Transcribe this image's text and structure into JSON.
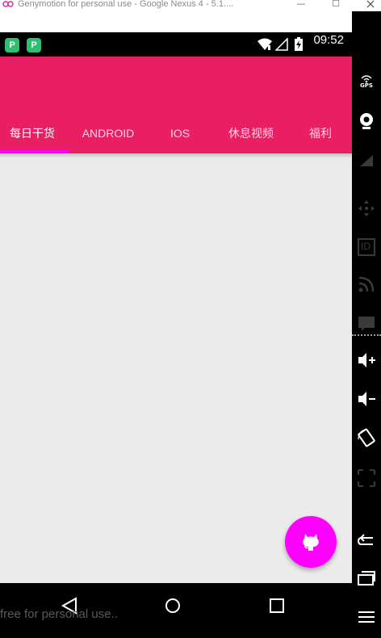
{
  "window": {
    "title": "Genymotion for personal use - Google Nexus 4 - 5.1....",
    "min_symbol": "—",
    "max_symbol": "☐"
  },
  "status_bar": {
    "time": "09:52",
    "notification_icons": [
      "P",
      "P"
    ]
  },
  "tabs": [
    {
      "label": "每日干货",
      "active": true
    },
    {
      "label": "ANDROID",
      "active": false
    },
    {
      "label": "IOS",
      "active": false
    },
    {
      "label": "休息视频",
      "active": false
    },
    {
      "label": "福利",
      "active": false
    }
  ],
  "fab": {
    "icon": "github-icon"
  },
  "navigation": {
    "watermark": "free for personal use..",
    "buttons": [
      "back-icon",
      "home-icon",
      "recents-icon"
    ]
  },
  "sidebar": {
    "gps_label": "GPS",
    "id_label": "ID",
    "items": [
      "gps-icon",
      "webcam-icon",
      "battery-icon",
      "dpad-icon",
      "device-id-icon",
      "rss-icon",
      "sms-icon",
      "volume-up-icon",
      "volume-down-icon",
      "rotate-icon",
      "screen-icon",
      "back-icon",
      "recents-icon",
      "menu-icon"
    ]
  },
  "colors": {
    "primary": "#e91e63",
    "accent": "#ff00ff",
    "background": "#ebebeb"
  }
}
